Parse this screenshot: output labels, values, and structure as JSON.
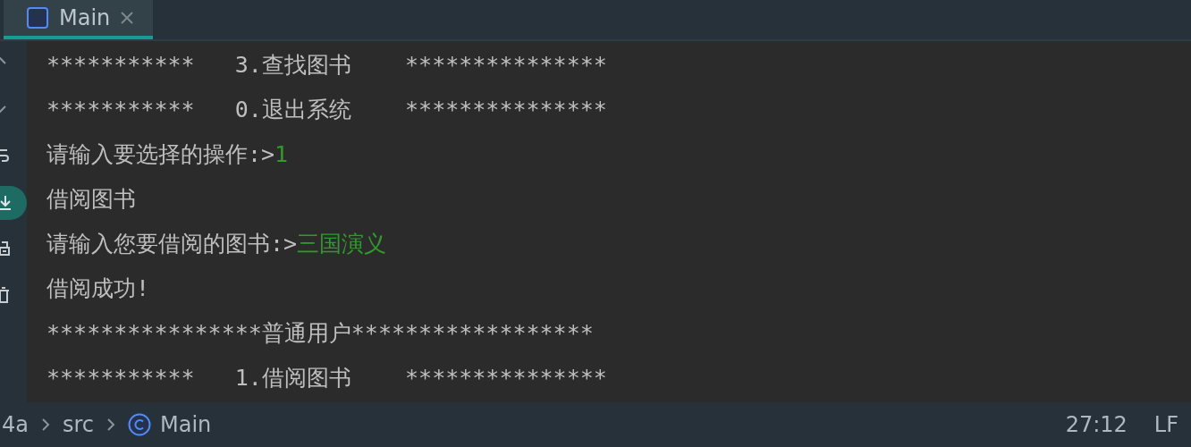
{
  "tabs": [
    {
      "label": "Main",
      "selected": true
    }
  ],
  "toolbar": [
    {
      "kind": "up",
      "on": false
    },
    {
      "kind": "down",
      "on": false
    },
    {
      "kind": "wrap",
      "on": false
    },
    {
      "kind": "scroll-end",
      "on": true
    },
    {
      "kind": "print",
      "on": false
    },
    {
      "kind": "trash",
      "on": false
    }
  ],
  "console": [
    {
      "text": "***********   3.查找图书    ***************"
    },
    {
      "text": "***********   0.退出系统    ***************"
    },
    {
      "text": "请输入要选择的操作:>",
      "input": "1"
    },
    {
      "text": "借阅图书"
    },
    {
      "text": "请输入您要借阅的图书:>",
      "input": "三国演义"
    },
    {
      "text": "借阅成功!"
    },
    {
      "text": "****************普通用户******************"
    },
    {
      "text": "***********   1.借阅图书    ***************"
    }
  ],
  "breadcrumb": [
    "4a",
    "src",
    "Main"
  ],
  "status_bar": [
    "27:12",
    "LF"
  ]
}
